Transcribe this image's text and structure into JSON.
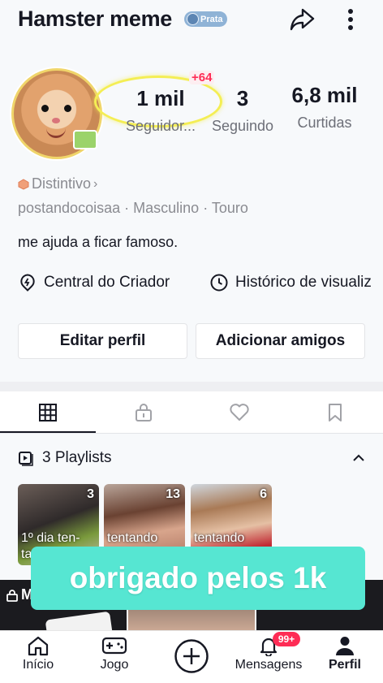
{
  "header": {
    "username": "Hamster meme",
    "tier_badge": "Prata",
    "share_icon": "share-arrow-icon",
    "menu_icon": "more-vertical-icon"
  },
  "stats": {
    "new_followers": "+64",
    "followers_value": "1 mil",
    "followers_label": "Seguidor...",
    "following_value": "3",
    "following_label": "Seguindo",
    "likes_value": "6,8 mil",
    "likes_label": "Curtidas"
  },
  "profile": {
    "badge_label": "Distintivo",
    "handle": "postandocoisaa",
    "gender": "Masculino",
    "sign": "Touro",
    "sep": "·",
    "bio": "me ajuda a ficar famoso."
  },
  "links": {
    "creator_center": "Central do Criador",
    "history": "Histórico de visualiz"
  },
  "buttons": {
    "edit_profile": "Editar perfil",
    "add_friends": "Adicionar amigos"
  },
  "tabs": [
    {
      "icon": "grid-icon"
    },
    {
      "icon": "lock-icon"
    },
    {
      "icon": "heart-icon"
    },
    {
      "icon": "bookmark-icon"
    }
  ],
  "playlists": {
    "header": "3 Playlists",
    "items": [
      {
        "count": "3",
        "title": "1º dia ten-",
        "title2": "ta"
      },
      {
        "count": "13",
        "title": "tentando"
      },
      {
        "count": "6",
        "title": "tentando"
      }
    ]
  },
  "grid_label": "M",
  "overlay_caption": "obrigado pelos 1k",
  "bottom_nav": {
    "home": "Início",
    "game": "Jogo",
    "messages": "Mensagens",
    "messages_badge": "99+",
    "profile": "Perfil"
  },
  "colors": {
    "accent": "#fe2c55",
    "overlay": "#56e6d2",
    "highlight": "#f4ee54"
  }
}
